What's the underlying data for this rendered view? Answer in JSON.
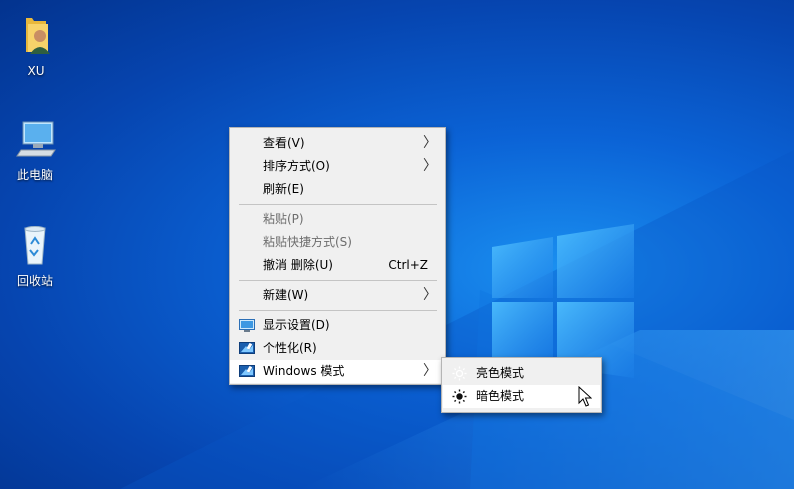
{
  "desktop": {
    "icons": [
      {
        "label": "XU",
        "icon": "user-folder-icon"
      },
      {
        "label": "此电脑",
        "icon": "computer-icon"
      },
      {
        "label": "回收站",
        "icon": "recycle-bin-icon"
      }
    ]
  },
  "context_menu": {
    "items": [
      {
        "label": "查看(V)",
        "submenu": true
      },
      {
        "label": "排序方式(O)",
        "submenu": true
      },
      {
        "label": "刷新(E)"
      },
      {
        "label": "粘贴(P)",
        "disabled": true
      },
      {
        "label": "粘贴快捷方式(S)",
        "disabled": true
      },
      {
        "label": "撤消 删除(U)",
        "shortcut": "Ctrl+Z"
      },
      {
        "label": "新建(W)",
        "submenu": true
      },
      {
        "label": "显示设置(D)",
        "icon": "display-settings-icon"
      },
      {
        "label": "个性化(R)",
        "icon": "personalize-icon"
      },
      {
        "label": "Windows 模式",
        "icon": "windows-mode-icon",
        "submenu": true,
        "highlighted": true
      }
    ],
    "arrow_glyph": "〉"
  },
  "submenu": {
    "items": [
      {
        "label": "亮色模式",
        "icon": "sun-outline-icon"
      },
      {
        "label": "暗色模式",
        "icon": "sun-filled-icon",
        "highlighted": true
      }
    ]
  },
  "colors": {
    "menu_bg": "#f0f0f0",
    "menu_hover": "#ffffff",
    "disabled_text": "#6d6d6d",
    "desktop_blue": "#0b63d6"
  }
}
